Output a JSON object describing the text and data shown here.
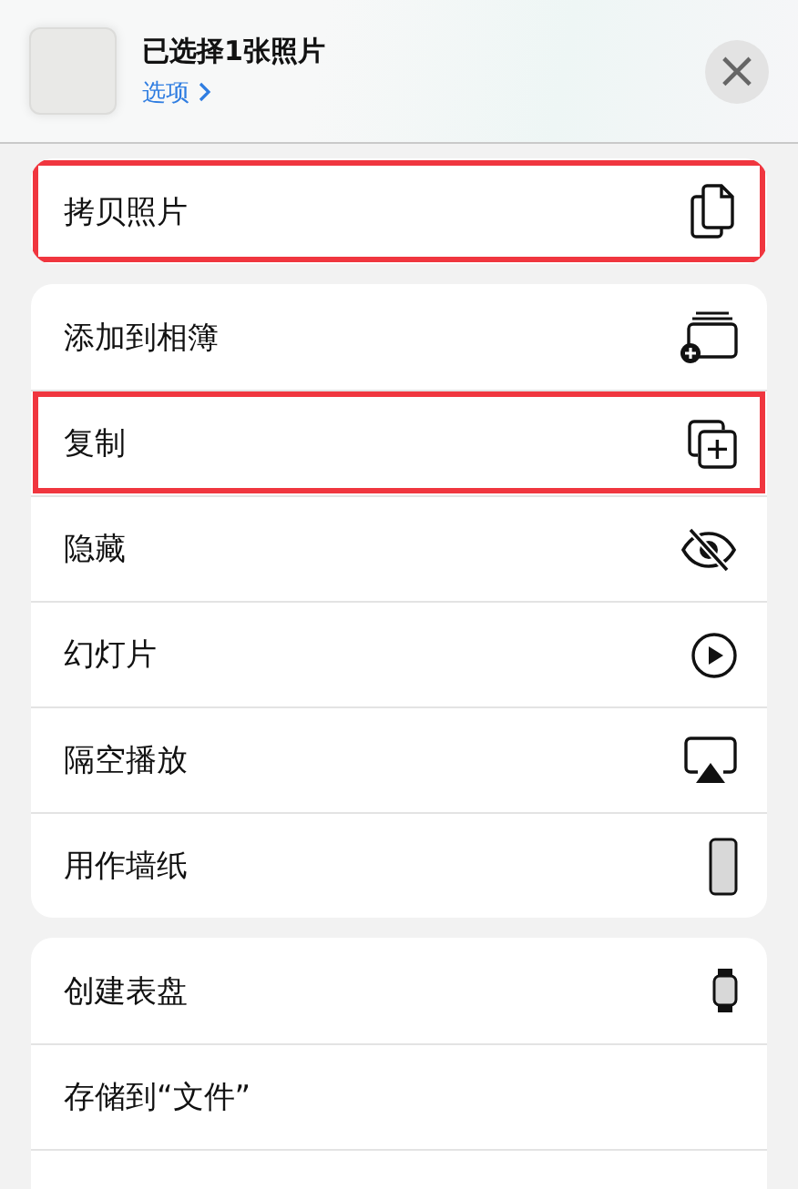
{
  "header": {
    "title": "已选择1张照片",
    "options_link": "选项",
    "close": "×"
  },
  "groups": [
    {
      "rows": [
        {
          "label": "拷贝照片",
          "kind": "copy",
          "highlighted": true
        }
      ]
    },
    {
      "rows": [
        {
          "label": "添加到相簿",
          "kind": "album",
          "highlighted": false
        },
        {
          "label": "复制",
          "kind": "duplicate",
          "highlighted": true
        },
        {
          "label": "隐藏",
          "kind": "hide",
          "highlighted": false
        },
        {
          "label": "幻灯片",
          "kind": "play",
          "highlighted": false
        },
        {
          "label": "隔空播放",
          "kind": "airplay",
          "highlighted": false
        },
        {
          "label": "用作墙纸",
          "kind": "phone",
          "highlighted": false
        }
      ]
    },
    {
      "rows": [
        {
          "label": "创建表盘",
          "kind": "watch",
          "highlighted": false
        },
        {
          "label": "存储到“文件”",
          "kind": "plain",
          "highlighted": false
        }
      ]
    }
  ]
}
